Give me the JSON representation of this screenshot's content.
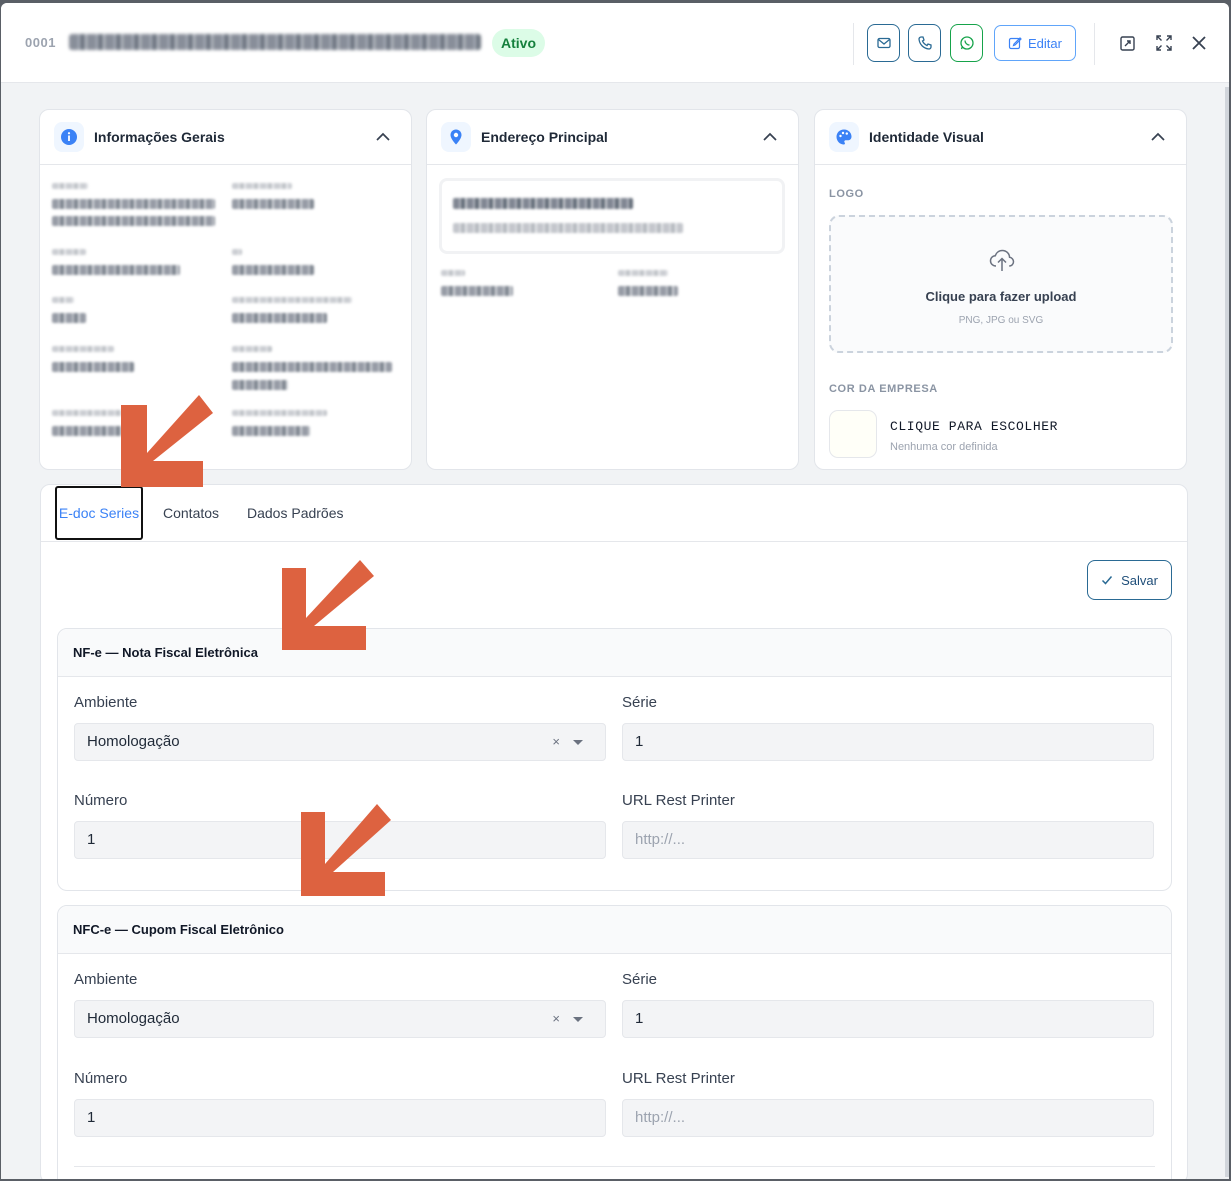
{
  "header": {
    "code": "0001",
    "status": "Ativo",
    "edit_label": "Editar"
  },
  "cards": {
    "info": {
      "title": "Informações Gerais"
    },
    "address": {
      "title": "Endereço Principal"
    },
    "identity": {
      "title": "Identidade Visual",
      "logo_label": "LOGO",
      "upload_title": "Clique para fazer upload",
      "upload_sub": "PNG, JPG ou SVG",
      "color_label": "COR DA EMPRESA",
      "color_pick": "CLIQUE PARA ESCOLHER",
      "color_sub": "Nenhuma cor definida"
    }
  },
  "tabs": [
    "E-doc Series",
    "Contatos",
    "Dados Padrões"
  ],
  "save_label": "Salvar",
  "sections": [
    {
      "title": "NF-e — Nota Fiscal Eletrônica",
      "ambiente_label": "Ambiente",
      "ambiente_value": "Homologação",
      "serie_label": "Série",
      "serie_value": "1",
      "numero_label": "Número",
      "numero_value": "1",
      "url_label": "URL Rest Printer",
      "url_placeholder": "http://..."
    },
    {
      "title": "NFC-e — Cupom Fiscal Eletrônico",
      "ambiente_label": "Ambiente",
      "ambiente_value": "Homologação",
      "serie_label": "Série",
      "serie_value": "1",
      "numero_label": "Número",
      "numero_value": "1",
      "url_label": "URL Rest Printer",
      "url_placeholder": "http://..."
    }
  ],
  "colors": {
    "accent": "#3b82f6",
    "status_bg": "#dcfce7",
    "status_fg": "#15803d",
    "arrow": "#dd6240"
  }
}
